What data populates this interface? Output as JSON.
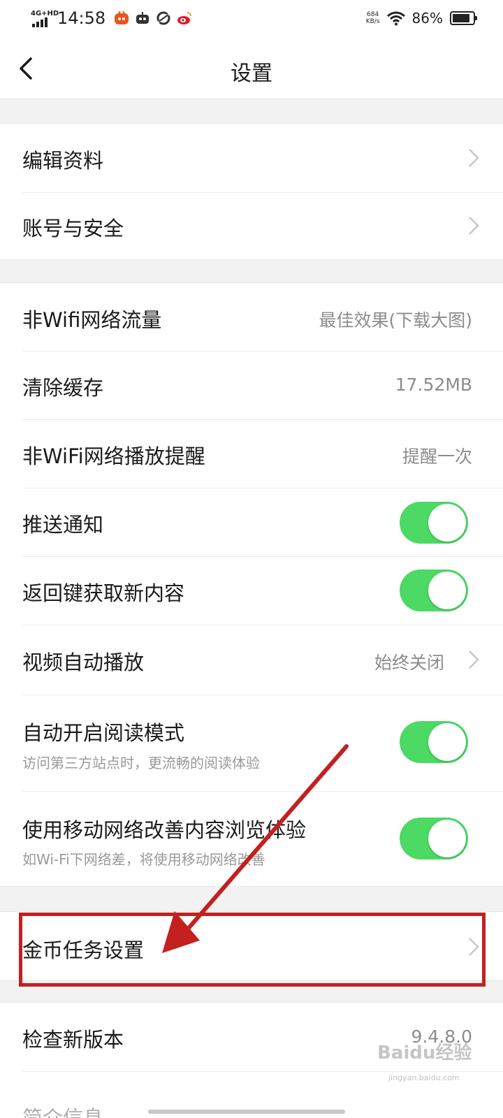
{
  "status_bar": {
    "network": "4G+HD",
    "time": "14:58",
    "speed_value": "684",
    "speed_unit": "KB/s",
    "battery_percent": "86%",
    "battery_level": 0.86
  },
  "nav": {
    "title": "设置"
  },
  "group1": [
    {
      "label": "编辑资料"
    },
    {
      "label": "账号与安全"
    }
  ],
  "group2": {
    "wifi_traffic": {
      "label": "非Wifi网络流量",
      "value": "最佳效果(下载大图)"
    },
    "clear_cache": {
      "label": "清除缓存",
      "value": "17.52MB"
    },
    "play_reminder": {
      "label": "非WiFi网络播放提醒",
      "value": "提醒一次"
    },
    "push": {
      "label": "推送通知",
      "on": true
    },
    "back_refresh": {
      "label": "返回键获取新内容",
      "on": true
    },
    "video_autoplay": {
      "label": "视频自动播放",
      "value": "始终关闭"
    },
    "reader_mode": {
      "label": "自动开启阅读模式",
      "sub": "访问第三方站点时，更流畅的阅读体验",
      "on": true
    },
    "mobile_boost": {
      "label": "使用移动网络改善内容浏览体验",
      "sub": "如Wi-Fi下网络差，将使用移动网络改善",
      "on": true
    }
  },
  "group3": {
    "coin_task": {
      "label": "金币任务设置"
    }
  },
  "group4": {
    "check_update": {
      "label": "检查新版本",
      "value": "9.4.8.0"
    },
    "next_label": "简介信息"
  },
  "watermark": {
    "brand": "Baidu经验",
    "url": "jingyan.baidu.com"
  },
  "colors": {
    "toggle_on": "#4cd964",
    "annotation_red": "#c2211f"
  }
}
